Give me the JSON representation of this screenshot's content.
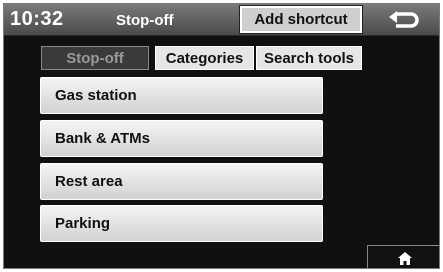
{
  "header": {
    "time": "10:32",
    "title": "Stop-off",
    "add_shortcut_label": "Add shortcut",
    "back_icon": "back-arrow-icon"
  },
  "tabs": [
    {
      "label": "Stop-off",
      "active": true
    },
    {
      "label": "Categories",
      "active": false
    },
    {
      "label": "Search tools",
      "active": false
    }
  ],
  "list": {
    "items": [
      {
        "label": "Gas station"
      },
      {
        "label": "Bank & ATMs"
      },
      {
        "label": "Rest area"
      },
      {
        "label": "Parking"
      }
    ]
  },
  "footer": {
    "home_icon": "home-icon"
  },
  "colors": {
    "screen_bg": "#101010",
    "header_bg": "#5a5a5a",
    "button_bg": "#e6e6e6",
    "active_tab_bg": "#3a3a3a"
  }
}
